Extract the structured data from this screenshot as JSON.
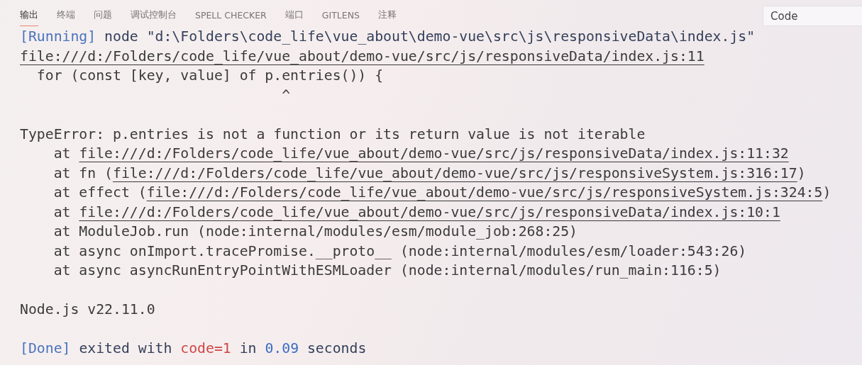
{
  "tabs": [
    {
      "label": "输出",
      "selected": true
    },
    {
      "label": "终端",
      "selected": false
    },
    {
      "label": "问题",
      "selected": false
    },
    {
      "label": "调试控制台",
      "selected": false
    },
    {
      "label": "SPELL CHECKER",
      "selected": false
    },
    {
      "label": "端口",
      "selected": false
    },
    {
      "label": "GITLENS",
      "selected": false
    },
    {
      "label": "注释",
      "selected": false
    }
  ],
  "channel_select": {
    "value": "Code"
  },
  "output_lines": [
    {
      "kind": "text",
      "segments": [
        {
          "kind": "info",
          "text": "[Running]"
        },
        {
          "kind": "message",
          "text": " node \"d:\\Folders\\code_life\\vue_about\\demo-vue\\src\\js\\responsiveData\\index.js\""
        }
      ]
    },
    {
      "kind": "text",
      "segments": [
        {
          "kind": "link",
          "text": "file:///d:/Folders/code_life/vue_about/demo-vue/src/js/responsiveData/index.js:11"
        }
      ]
    },
    {
      "kind": "text",
      "segments": [
        {
          "kind": "plain",
          "text": "  for (const [key, value] of p.entries()) {"
        }
      ]
    },
    {
      "kind": "text",
      "segments": [
        {
          "kind": "plain",
          "text": "                               ^"
        }
      ]
    },
    {
      "kind": "blank"
    },
    {
      "kind": "text",
      "segments": [
        {
          "kind": "plain",
          "text": "TypeError: p.entries is not a function or its return value is not iterable"
        }
      ]
    },
    {
      "kind": "text",
      "segments": [
        {
          "kind": "plain",
          "text": "    at "
        },
        {
          "kind": "link",
          "text": "file:///d:/Folders/code_life/vue_about/demo-vue/src/js/responsiveData/index.js:11:32"
        }
      ]
    },
    {
      "kind": "text",
      "segments": [
        {
          "kind": "plain",
          "text": "    at fn ("
        },
        {
          "kind": "link",
          "text": "file:///d:/Folders/code_life/vue_about/demo-vue/src/js/responsiveSystem.js:316:17"
        },
        {
          "kind": "plain",
          "text": ")"
        }
      ]
    },
    {
      "kind": "text",
      "segments": [
        {
          "kind": "plain",
          "text": "    at effect ("
        },
        {
          "kind": "link",
          "text": "file:///d:/Folders/code_life/vue_about/demo-vue/src/js/responsiveSystem.js:324:5"
        },
        {
          "kind": "plain",
          "text": ")"
        }
      ]
    },
    {
      "kind": "text",
      "segments": [
        {
          "kind": "plain",
          "text": "    at "
        },
        {
          "kind": "link",
          "text": "file:///d:/Folders/code_life/vue_about/demo-vue/src/js/responsiveData/index.js:10:1"
        }
      ]
    },
    {
      "kind": "text",
      "segments": [
        {
          "kind": "plain",
          "text": "    at ModuleJob.run (node:internal/modules/esm/module_job:268:25)"
        }
      ]
    },
    {
      "kind": "text",
      "segments": [
        {
          "kind": "plain",
          "text": "    at async onImport.tracePromise.__proto__ (node:internal/modules/esm/loader:543:26)"
        }
      ]
    },
    {
      "kind": "text",
      "segments": [
        {
          "kind": "plain",
          "text": "    at async asyncRunEntryPointWithESMLoader (node:internal/modules/run_main:116:5)"
        }
      ]
    },
    {
      "kind": "blank"
    },
    {
      "kind": "text",
      "segments": [
        {
          "kind": "plain",
          "text": "Node.js v22.11.0"
        }
      ]
    },
    {
      "kind": "blank"
    },
    {
      "kind": "text",
      "segments": [
        {
          "kind": "info",
          "text": "[Done]"
        },
        {
          "kind": "message",
          "text": " exited with "
        },
        {
          "kind": "error",
          "text": "code=1"
        },
        {
          "kind": "message",
          "text": " in "
        },
        {
          "kind": "number",
          "text": "0.09"
        },
        {
          "kind": "message",
          "text": " seconds"
        }
      ]
    }
  ]
}
